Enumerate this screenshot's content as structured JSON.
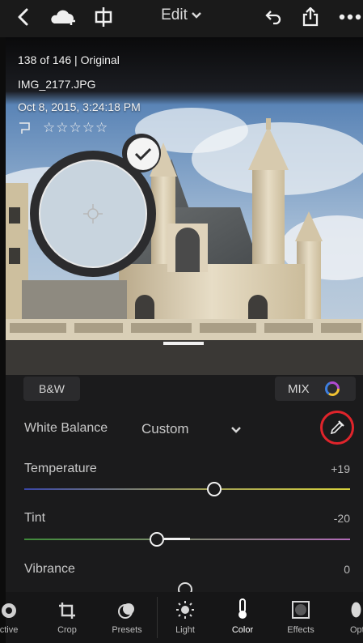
{
  "topbar": {
    "back_icon": "chevron-left-icon",
    "cloud_icon": "cloud-add-icon",
    "crop_compare_icon": "compare-icon",
    "title": "Edit",
    "title_caret_icon": "chevron-down-icon",
    "undo_icon": "undo-icon",
    "share_icon": "share-icon",
    "more_icon": "more-icon"
  },
  "photo_info": {
    "position": "138 of 146 | Original",
    "filename": "IMG_2177.JPG",
    "datetime": "Oct 8, 2015, 3:24:18 PM",
    "flag_icon": "flag-icon",
    "rating_stars": 0,
    "rating_max": 5
  },
  "loupe": {
    "confirm_icon": "check-icon",
    "target_icon": "crosshair-icon"
  },
  "panel": {
    "bw_label": "B&W",
    "mix_label": "MIX",
    "mix_icon": "color-wheel-icon",
    "white_balance_label": "White Balance",
    "white_balance_value": "Custom",
    "white_balance_caret_icon": "chevron-down-icon",
    "eyedropper_icon": "eyedropper-icon",
    "highlight_color": "#e0242b",
    "sliders": [
      {
        "label": "Temperature",
        "value": "+19",
        "level": 0.59
      },
      {
        "label": "Tint",
        "value": "-20",
        "level": 0.4
      },
      {
        "label": "Vibrance",
        "value": "0",
        "level": 0.5
      }
    ]
  },
  "bottom_nav": {
    "items": [
      {
        "label": "ctive",
        "icon": "perspective-icon"
      },
      {
        "label": "Crop",
        "icon": "crop-icon"
      },
      {
        "label": "Presets",
        "icon": "presets-icon"
      },
      {
        "label": "Light",
        "icon": "sun-icon"
      },
      {
        "label": "Color",
        "icon": "thermometer-icon",
        "active": true
      },
      {
        "label": "Effects",
        "icon": "effects-icon"
      },
      {
        "label": "Opt",
        "icon": "optics-icon"
      }
    ]
  }
}
